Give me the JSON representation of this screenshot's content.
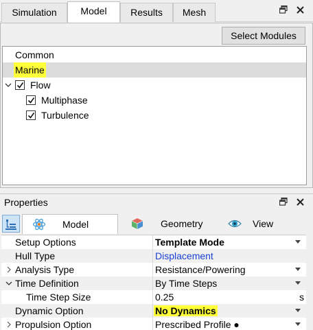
{
  "tabs": [
    {
      "label": "Simulation"
    },
    {
      "label": "Model"
    },
    {
      "label": "Results"
    },
    {
      "label": "Mesh"
    }
  ],
  "window_controls": {
    "pin": "⧉",
    "close": "✕"
  },
  "select_modules_label": "Select Modules",
  "modules_tree": {
    "common": "Common",
    "marine": "Marine",
    "flow": "Flow",
    "multiphase": "Multiphase",
    "turbulence": "Turbulence"
  },
  "properties": {
    "title": "Properties",
    "tabs": [
      {
        "label": "Model",
        "icon": "atom-icon"
      },
      {
        "label": "Geometry",
        "icon": "cube-icon"
      },
      {
        "label": "View",
        "icon": "eye-icon"
      }
    ],
    "rows": [
      {
        "name": "Setup Options",
        "value": "Template Mode"
      },
      {
        "name": "Hull Type",
        "value": "Displacement"
      },
      {
        "name": "Analysis Type",
        "value": "Resistance/Powering"
      },
      {
        "name": "Time Definition",
        "value": "By Time Steps"
      },
      {
        "name": "Time Step Size",
        "value": "0.25",
        "unit": "s"
      },
      {
        "name": "Dynamic Option",
        "value": "No Dynamics"
      },
      {
        "name": "Propulsion Option",
        "value": "Prescribed Profile ●"
      }
    ]
  },
  "colors": {
    "highlight": "#ffff3a",
    "link": "#1a3fd6",
    "selection": "#dcdcdc"
  }
}
